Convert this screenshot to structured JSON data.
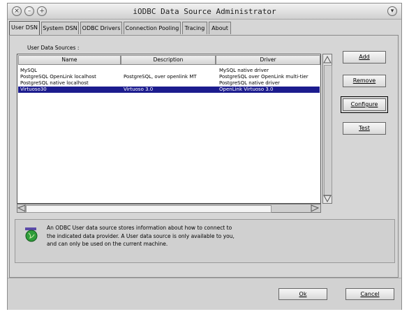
{
  "window": {
    "title": "iODBC Data Source Administrator"
  },
  "tabs": [
    {
      "label": "User DSN"
    },
    {
      "label": "System DSN"
    },
    {
      "label": "ODBC Drivers"
    },
    {
      "label": "Connection Pooling"
    },
    {
      "label": "Tracing"
    },
    {
      "label": "About"
    }
  ],
  "section_label": "User Data Sources :",
  "table": {
    "columns": [
      "Name",
      "Description",
      "Driver"
    ],
    "rows": [
      {
        "name": "MySQL",
        "description": "",
        "driver": "MySQL native driver"
      },
      {
        "name": "PostgreSQL OpenLink localhost",
        "description": "PostgreSQL, over openlink MT",
        "driver": "PostgreSQL over OpenLink multi-tier"
      },
      {
        "name": "PostgreSQL native localhost",
        "description": "",
        "driver": "PostgreSQL native driver"
      },
      {
        "name": "Virtuoso30",
        "description": "Virtuoso 3.0",
        "driver": "OpenLink Virtuoso 3.0"
      }
    ],
    "selected_row": 3
  },
  "side_buttons": {
    "add": "Add",
    "remove": "Remove",
    "configure": "Configure",
    "test": "Test"
  },
  "info": {
    "icon": "odbc-globe-icon",
    "line1": "An ODBC User data source stores information about how to connect to",
    "line2": "the indicated data provider. A User data source is only available to you,",
    "line3": "and can only be used on the current machine."
  },
  "footer": {
    "ok": "Ok",
    "cancel": "Cancel"
  },
  "colors": {
    "selection": "#1c1c8e",
    "window_bg": "#d6d6d6"
  }
}
